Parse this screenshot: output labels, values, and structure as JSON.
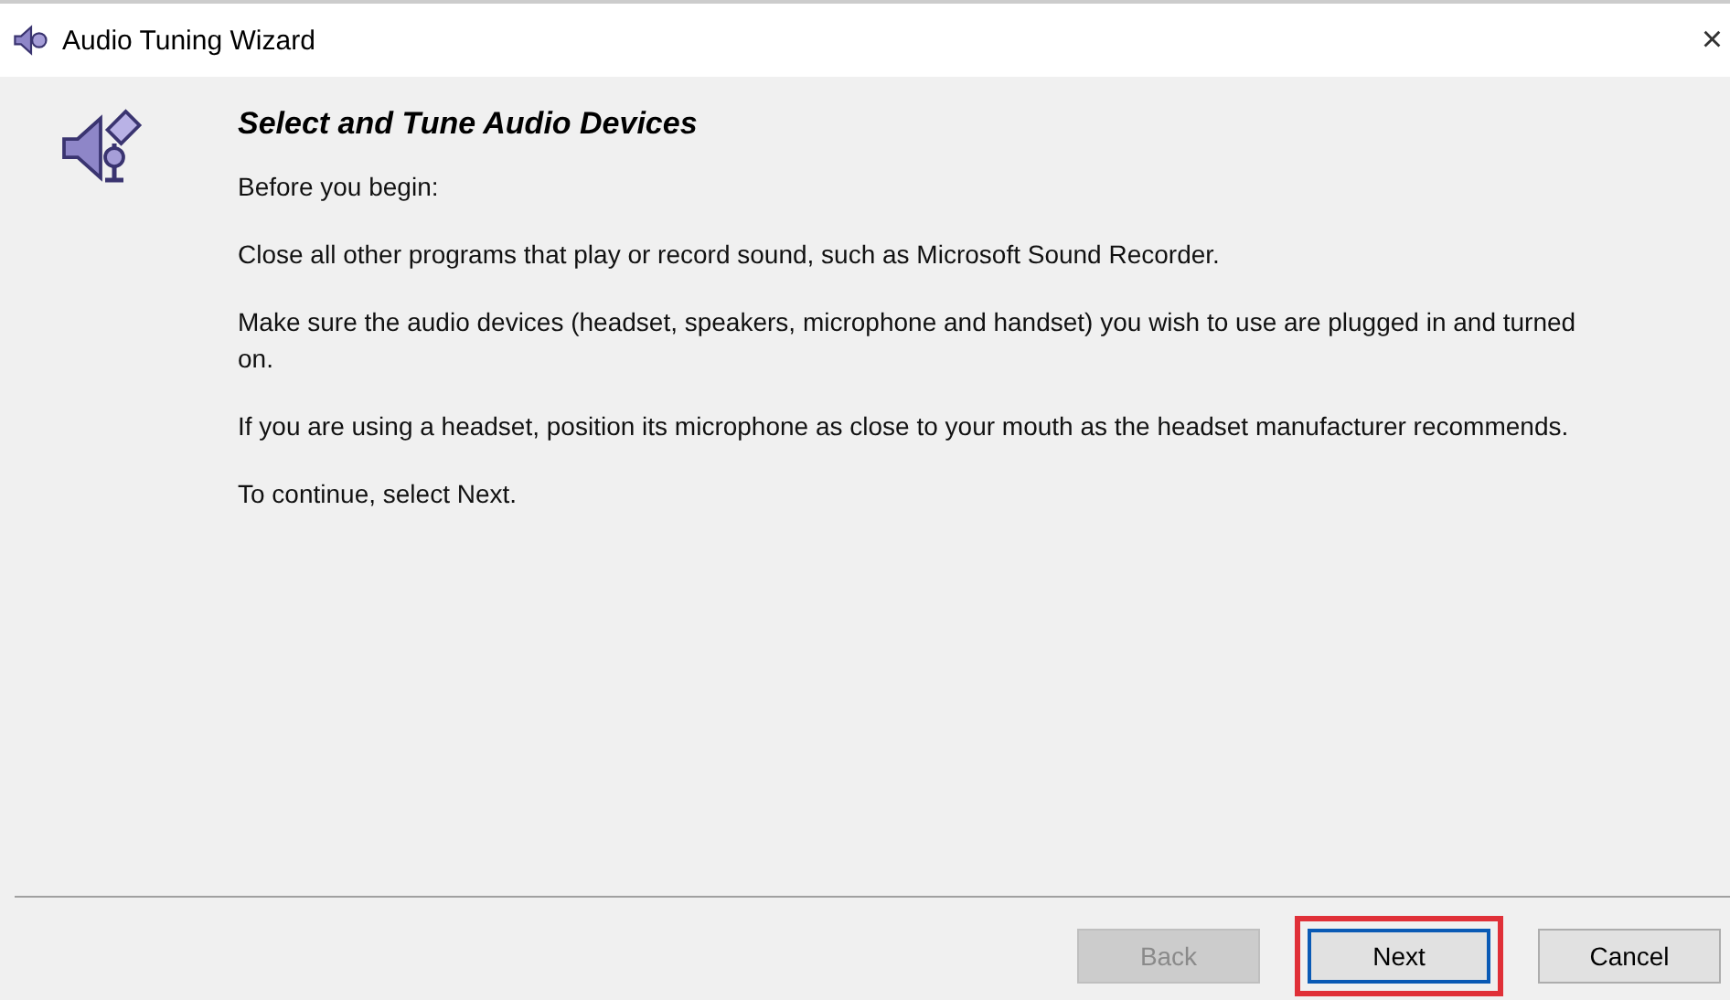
{
  "window": {
    "title": "Audio Tuning Wizard",
    "close": "×"
  },
  "page": {
    "heading": "Select and Tune Audio Devices",
    "paragraphs": [
      "Before you begin:",
      "Close all other programs that play or record sound, such as Microsoft Sound Recorder.",
      "Make sure the audio devices (headset, speakers, microphone and handset) you wish to use are plugged in and turned on.",
      "If you are using a headset, position its microphone as close to your mouth as the headset manufacturer recommends.",
      "To continue, select Next."
    ]
  },
  "buttons": [
    {
      "label": "Back",
      "disabled": true,
      "default": false,
      "highlighted": false
    },
    {
      "label": "Next",
      "disabled": false,
      "default": true,
      "highlighted": true
    },
    {
      "label": "Cancel",
      "disabled": false,
      "default": false,
      "highlighted": false
    }
  ]
}
